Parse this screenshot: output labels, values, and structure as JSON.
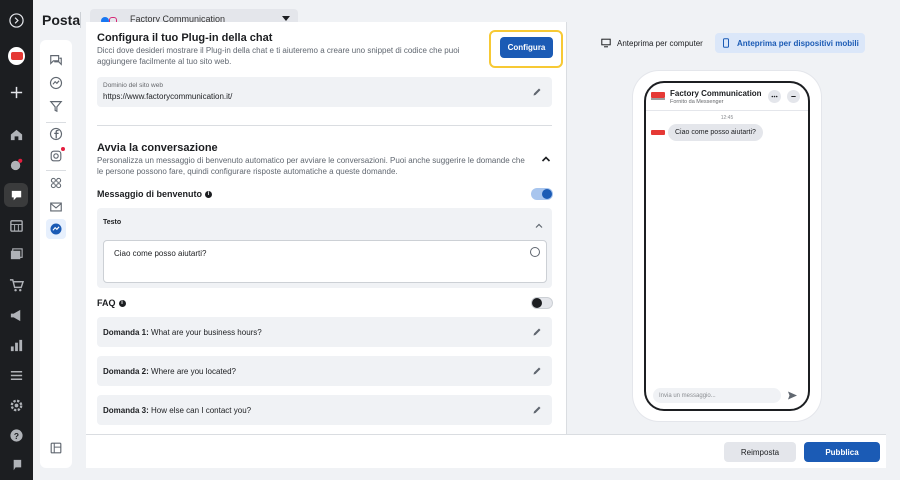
{
  "header": {
    "title": "Posta",
    "page_selector": "Factory Communication"
  },
  "config_section": {
    "title": "Configura il tuo Plug-in della chat",
    "description": "Dicci dove desideri mostrare il Plug-in della chat e ti aiuteremo a creare uno snippet di codice che puoi aggiungere facilmente al tuo sito web.",
    "button": "Configura",
    "domain_label": "Dominio del sito web",
    "domain_value": "https://www.factorycommunication.it/"
  },
  "conversation_section": {
    "title": "Avvia la conversazione",
    "description": "Personalizza un messaggio di benvenuto automatico per avviare le conversazioni. Puoi anche suggerire le domande che le persone possono fare, quindi configurare risposte automatiche a queste domande.",
    "welcome_label": "Messaggio di benvenuto",
    "welcome_enabled": true,
    "text_label": "Testo",
    "text_value": "Ciao come posso aiutarti?",
    "faq_label": "FAQ",
    "faq_enabled": false,
    "questions": [
      {
        "label": "Domanda 1:",
        "text": "What are your business hours?"
      },
      {
        "label": "Domanda 2:",
        "text": "Where are you located?"
      },
      {
        "label": "Domanda 3:",
        "text": "How else can I contact you?"
      }
    ]
  },
  "preview": {
    "tab_desktop": "Anteprima per computer",
    "tab_mobile": "Anteprima per dispositivi mobili",
    "page_name": "Factory Communication",
    "page_sub": "Fornito da Messenger",
    "time": "12:45",
    "message": "Ciao come posso aiutarti?",
    "input_placeholder": "Invia un messaggio..."
  },
  "footer": {
    "reset": "Reimposta",
    "publish": "Pubblica"
  },
  "colors": {
    "primary": "#1b5bb5",
    "highlight": "#f7c934",
    "nav_bg": "#1c1e21"
  }
}
